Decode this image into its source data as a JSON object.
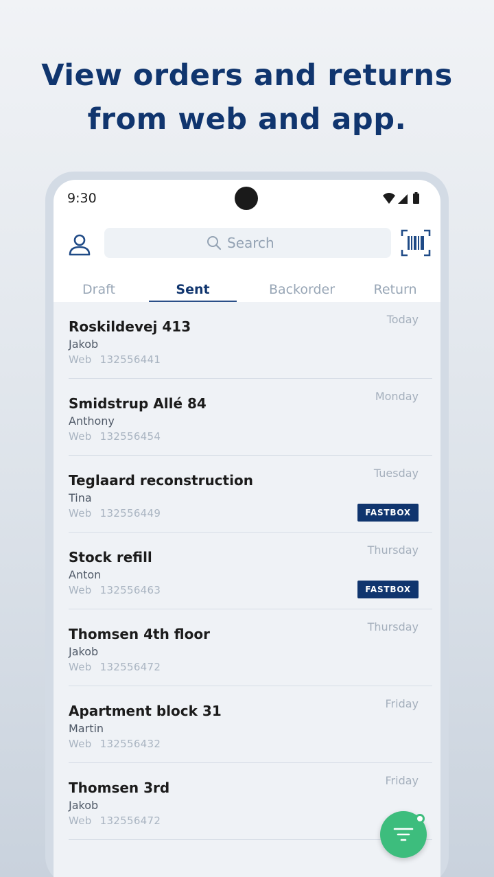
{
  "headline": {
    "line1": "View orders and returns",
    "line2": "from web and app."
  },
  "status_bar": {
    "time": "9:30",
    "icons": [
      "wifi-icon",
      "signal-icon",
      "battery-icon"
    ]
  },
  "header": {
    "search_placeholder": "Search",
    "profile_icon": "user-icon",
    "scan_icon": "barcode-scan-icon"
  },
  "tabs": [
    {
      "label": "Draft",
      "active": false
    },
    {
      "label": "Sent",
      "active": true
    },
    {
      "label": "Backorder",
      "active": false
    },
    {
      "label": "Return",
      "active": false
    }
  ],
  "orders": [
    {
      "title": "Roskildevej 413",
      "person": "Jakob",
      "source": "Web",
      "number": "132556441",
      "day": "Today",
      "badge": ""
    },
    {
      "title": "Smidstrup Allé 84",
      "person": "Anthony",
      "source": "Web",
      "number": "132556454",
      "day": "Monday",
      "badge": ""
    },
    {
      "title": "Teglaard reconstruction",
      "person": "Tina",
      "source": "Web",
      "number": "132556449",
      "day": "Tuesday",
      "badge": "FASTBOX"
    },
    {
      "title": "Stock refill",
      "person": "Anton",
      "source": "Web",
      "number": "132556463",
      "day": "Thursday",
      "badge": "FASTBOX"
    },
    {
      "title": "Thomsen 4th floor",
      "person": "Jakob",
      "source": "Web",
      "number": "132556472",
      "day": "Thursday",
      "badge": ""
    },
    {
      "title": "Apartment block 31",
      "person": "Martin",
      "source": "Web",
      "number": "132556432",
      "day": "Friday",
      "badge": ""
    },
    {
      "title": "Thomsen 3rd",
      "person": "Jakob",
      "source": "Web",
      "number": "132556472",
      "day": "Friday",
      "badge": ""
    }
  ],
  "fab": {
    "icon": "filter-icon"
  },
  "colors": {
    "brand_navy": "#10356e",
    "fab_green": "#3dbd7d",
    "list_background": "#eff2f6"
  }
}
